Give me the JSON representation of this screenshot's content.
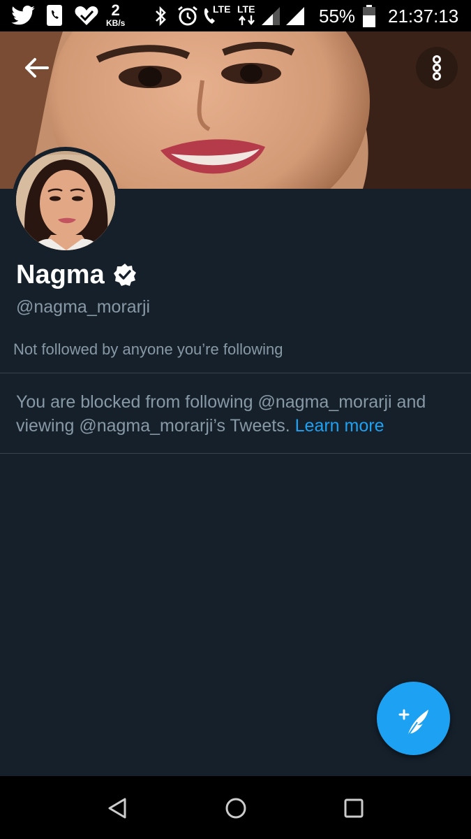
{
  "status_bar": {
    "net_speed_value": "2",
    "net_speed_unit": "KB/s",
    "lte_1": "LTE",
    "lte_2": "LTE",
    "battery": "55%",
    "time": "21:37:13"
  },
  "profile": {
    "name": "Nagma",
    "handle": "@nagma_morarji",
    "followed_by_text": "Not followed by anyone you’re following",
    "blocked_text": "You are blocked from following @nagma_morarji and viewing @nagma_morarji’s Tweets.",
    "learn_more": "Learn more"
  },
  "colors": {
    "background": "#15202b",
    "accent": "#1da1f2",
    "secondary_text": "#8899a6"
  }
}
